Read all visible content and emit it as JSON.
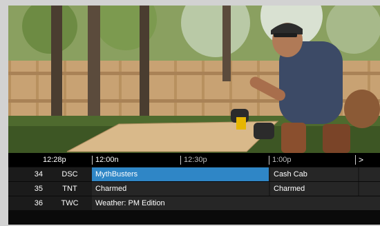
{
  "guide": {
    "current_time": "12:28p",
    "time_slots": [
      "12:00n",
      "12:30p",
      "1:00p"
    ],
    "next_arrow": ">",
    "rows": [
      {
        "number": "34",
        "callsign": "DSC",
        "programs": [
          "MythBusters",
          "Cash Cab",
          ""
        ]
      },
      {
        "number": "35",
        "callsign": "TNT",
        "programs": [
          "Charmed",
          "Charmed",
          ""
        ]
      },
      {
        "number": "36",
        "callsign": "TWC",
        "programs": [
          "Weather: PM Edition"
        ]
      }
    ]
  },
  "colors": {
    "selected_cell": "#2f86c6",
    "guide_background": "#1b1b1b"
  }
}
